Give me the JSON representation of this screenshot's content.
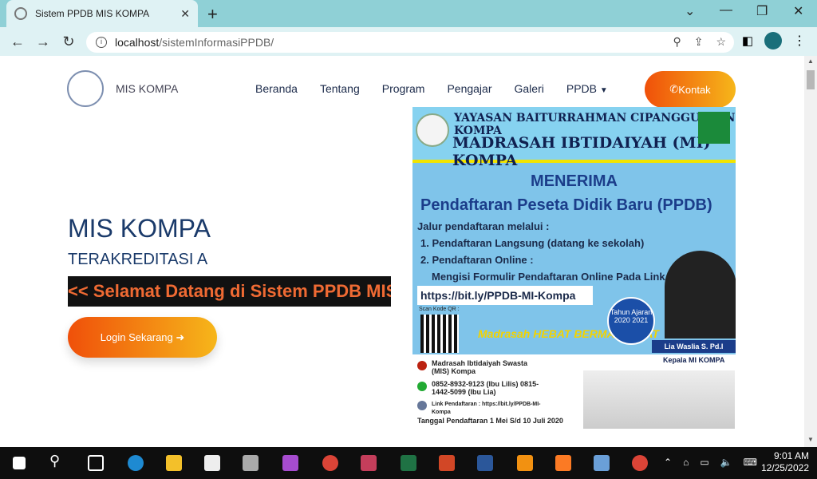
{
  "browser": {
    "tab_title": "Sistem PPDB MIS KOMPA",
    "url_host": "localhost",
    "url_path": "/sistemInformasiPPDB/"
  },
  "nav": {
    "brand": "MIS KOMPA",
    "items": [
      "Beranda",
      "Tentang",
      "Program",
      "Pengajar",
      "Galeri",
      "PPDB"
    ],
    "contact_label": "Kontak"
  },
  "hero": {
    "title": "MIS KOMPA",
    "subtitle": "TERAKREDITASI A",
    "marquee": "<< Selamat Datang di Sistem PPDB MIS",
    "login_label": "Login Sekarang"
  },
  "poster": {
    "org": "YAYASAN BAITURRAHMAN CIPANGGULAAN KOMPA",
    "school": "MADRASAH IBTIDAIYAH (MI) KOMPA",
    "menerima": "MENERIMA",
    "ppdb": "Pendaftaran Peseta Didik Baru (PPDB)",
    "jalur": "Jalur pendaftaran melalui :",
    "opt1": "1. Pendaftaran Langsung (datang ke sekolah)",
    "opt2": "2. Pendaftaran Online :",
    "opt2b": "Mengisi Formulir Pendaftaran Online Pada Link :",
    "link": "https://bit.ly/PPDB-MI-Kompa",
    "scan": "Scan Kode QR :",
    "hebat": "Madrasah HEBAT BERMARTABAT",
    "tahun": "Tahun Ajaran 2020 2021",
    "person_name": "Lia Waslia S. Pd.I",
    "kepala": "Kepala MI KOMPA",
    "madrasah": "Madrasah Ibtidaiyah Swasta (MIS) Kompa",
    "phone": "0852-8932-9123 (Ibu Lilis) 0815-1442-5099 (Ibu Lia)",
    "link_label": "Link Pendaftaran : https://bit.ly/PPDB-MI-Kompa",
    "tanggal": "Tanggal Pendaftaran 1 Mei S/d 10 Juli 2020"
  },
  "taskbar": {
    "time": "9:01 AM",
    "date": "12/25/2022"
  }
}
